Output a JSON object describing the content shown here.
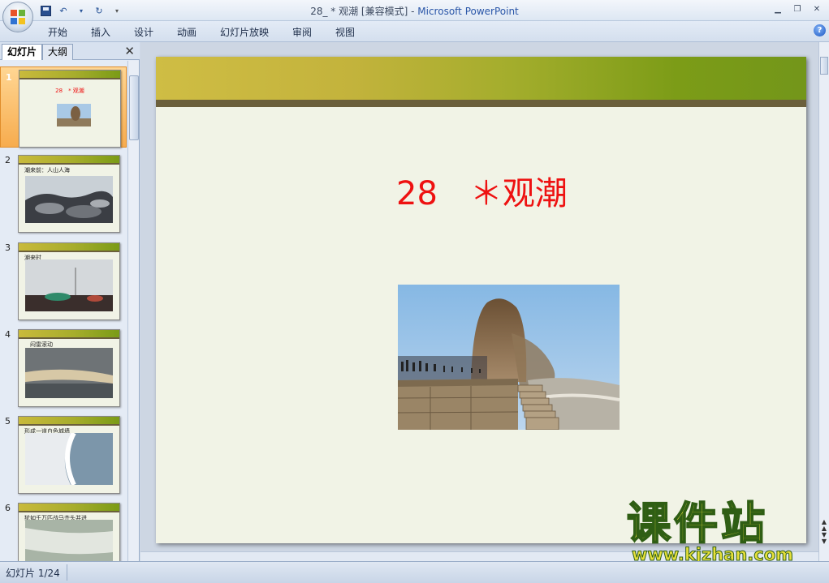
{
  "window": {
    "title_doc": "28_ * 观潮 [兼容模式] - ",
    "title_app": "Microsoft PowerPoint",
    "controls": [
      "minimize-icon",
      "restore-icon",
      "close-icon"
    ]
  },
  "quick_access": [
    "save-icon",
    "undo-icon",
    "redo-icon",
    "customize-icon"
  ],
  "ribbon": {
    "tabs": [
      {
        "label": "开始"
      },
      {
        "label": "插入"
      },
      {
        "label": "设计"
      },
      {
        "label": "动画"
      },
      {
        "label": "幻灯片放映"
      },
      {
        "label": "审阅"
      },
      {
        "label": "视图"
      }
    ],
    "help": "?"
  },
  "panel": {
    "tab_slides": "幻灯片",
    "tab_outline": "大纲",
    "close": "✕"
  },
  "thumbnails": [
    {
      "num": "1",
      "caption": "",
      "title": "28　* 观潮",
      "selected": true
    },
    {
      "num": "2",
      "caption": "潮来前：人山人海",
      "title": ""
    },
    {
      "num": "3",
      "caption": "潮来时",
      "title": ""
    },
    {
      "num": "4",
      "caption": "闷雷滚动",
      "title": ""
    },
    {
      "num": "5",
      "caption": "形成一道白色城墙",
      "title": ""
    },
    {
      "num": "6",
      "caption": "犹如千万匹战马齐头并进",
      "title": ""
    }
  ],
  "slide": {
    "title": "28　＊观潮"
  },
  "watermark": {
    "cn": "课件站",
    "url": "www.kjzhan.com"
  },
  "status": {
    "slide_indicator": "幻灯片 1/24"
  },
  "colors": {
    "title_red": "#ee1111",
    "band_yellow": "#cfbd44",
    "band_green": "#7c9c17",
    "band_brown": "#6b5f3b",
    "slide_bg": "#f1f3e6"
  }
}
